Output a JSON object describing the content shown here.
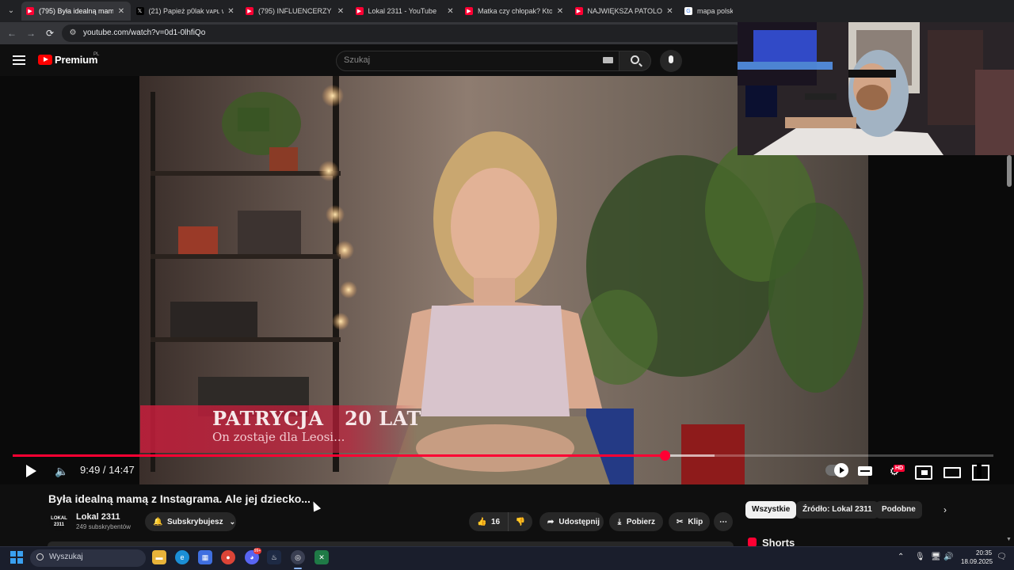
{
  "browser": {
    "tabs": [
      {
        "title": "(795) Była idealną mamą",
        "icon": "youtube-icon",
        "active": true
      },
      {
        "title": "(21) Papież p0lak ᴠᴀᴘʟ w",
        "icon": "x-icon",
        "active": false
      },
      {
        "title": "(795) INFLUENCERZY OF!",
        "icon": "youtube-icon",
        "active": false
      },
      {
        "title": "Lokal 2311 - YouTube",
        "icon": "youtube-icon",
        "active": false
      },
      {
        "title": "Matka czy chłopak? Kto n",
        "icon": "youtube-icon",
        "active": false
      },
      {
        "title": "NAJWIĘKSZA PATOLOGIA",
        "icon": "youtube-icon",
        "active": false
      },
      {
        "title": "mapa polski - S",
        "icon": "google-icon",
        "active": false
      }
    ],
    "url": "youtube.com/watch?v=0d1-0lhfiQo"
  },
  "youtube": {
    "brand": "Premium",
    "region": "PL",
    "search_placeholder": "Szukaj"
  },
  "player": {
    "overlay_name": "PATRYCJA   20 LAT",
    "overlay_subtitle": "On zostaje dla Leosi...",
    "time_display": "9:49 / 14:47",
    "progress_fraction": 0.6648,
    "settings_badge": "HD"
  },
  "video": {
    "title": "Była idealną mamą z Instagrama. Ale jej dziecko...",
    "channel_avatar_text": "LOKAL 2311",
    "channel_name": "Lokal 2311",
    "subscribers": "249 subskrybentów",
    "subscribe_label": "Subskrybujesz",
    "likes": "16",
    "share_label": "Udostępnij",
    "download_label": "Pobierz",
    "clip_label": "Klip",
    "more_label": "⋯"
  },
  "sidebar": {
    "chips": [
      "Wszystkie",
      "Źródło: Lokal 2311",
      "Podobne"
    ],
    "next_glyph": "›",
    "section_title": "Shorts"
  },
  "taskbar": {
    "search_label": "Wyszukaj",
    "steam_badge": "99+",
    "time": "20:35",
    "date": "18.09.2025"
  },
  "colors": {
    "accent_red": "#ff0033",
    "background": "#0f0f0f",
    "chip_active_bg": "#f1f1f1",
    "overlay_red": "#c81e3c"
  }
}
